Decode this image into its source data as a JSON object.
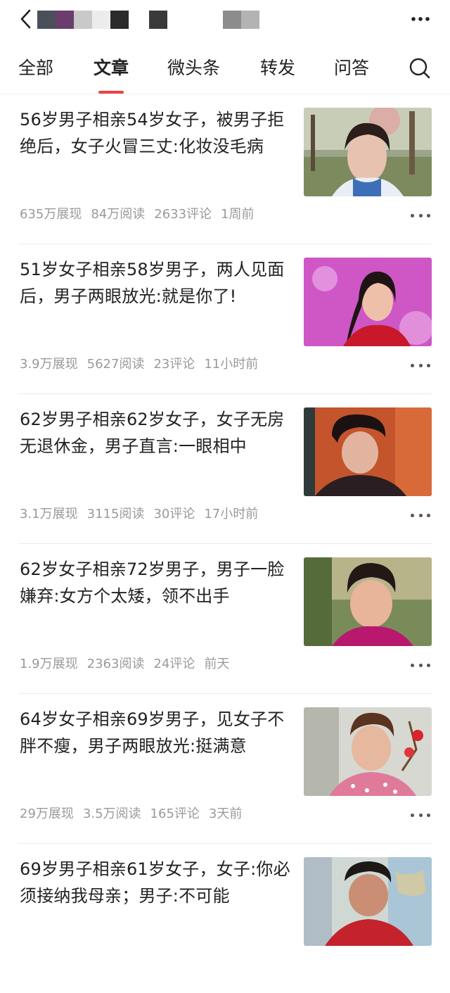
{
  "colors": {
    "accent": "#f04142",
    "text": "#222222",
    "meta": "#9a9a9a"
  },
  "topbar": {
    "back_icon": "chevron-left-icon",
    "more_icon": "more-horizontal-icon"
  },
  "tabs": [
    {
      "label": "全部",
      "active": false
    },
    {
      "label": "文章",
      "active": true
    },
    {
      "label": "微头条",
      "active": false
    },
    {
      "label": "转发",
      "active": false
    },
    {
      "label": "问答",
      "active": false
    }
  ],
  "search_icon": "search-icon",
  "articles": [
    {
      "title": "56岁男子相亲54岁女子，被男子拒绝后，女子火冒三丈:化妆没毛病",
      "views": "635万展现",
      "reads": "84万阅读",
      "comments": "2633评论",
      "time": "1周前"
    },
    {
      "title": "51岁女子相亲58岁男子，两人见面后，男子两眼放光:就是你了!",
      "views": "3.9万展现",
      "reads": "5627阅读",
      "comments": "23评论",
      "time": "11小时前"
    },
    {
      "title": "62岁男子相亲62岁女子，女子无房无退休金，男子直言:一眼相中",
      "views": "3.1万展现",
      "reads": "3115阅读",
      "comments": "30评论",
      "time": "17小时前"
    },
    {
      "title": "62岁女子相亲72岁男子，男子一脸嫌弃:女方个太矮，领不出手",
      "views": "1.9万展现",
      "reads": "2363阅读",
      "comments": "24评论",
      "time": "前天"
    },
    {
      "title": "64岁女子相亲69岁男子，见女子不胖不瘦，男子两眼放光:挺满意",
      "views": "29万展现",
      "reads": "3.5万阅读",
      "comments": "165评论",
      "time": "3天前"
    },
    {
      "title": "69岁男子相亲61岁女子，女子:你必须接纳我母亲；男子:不可能",
      "views": "",
      "reads": "",
      "comments": "",
      "time": ""
    }
  ]
}
